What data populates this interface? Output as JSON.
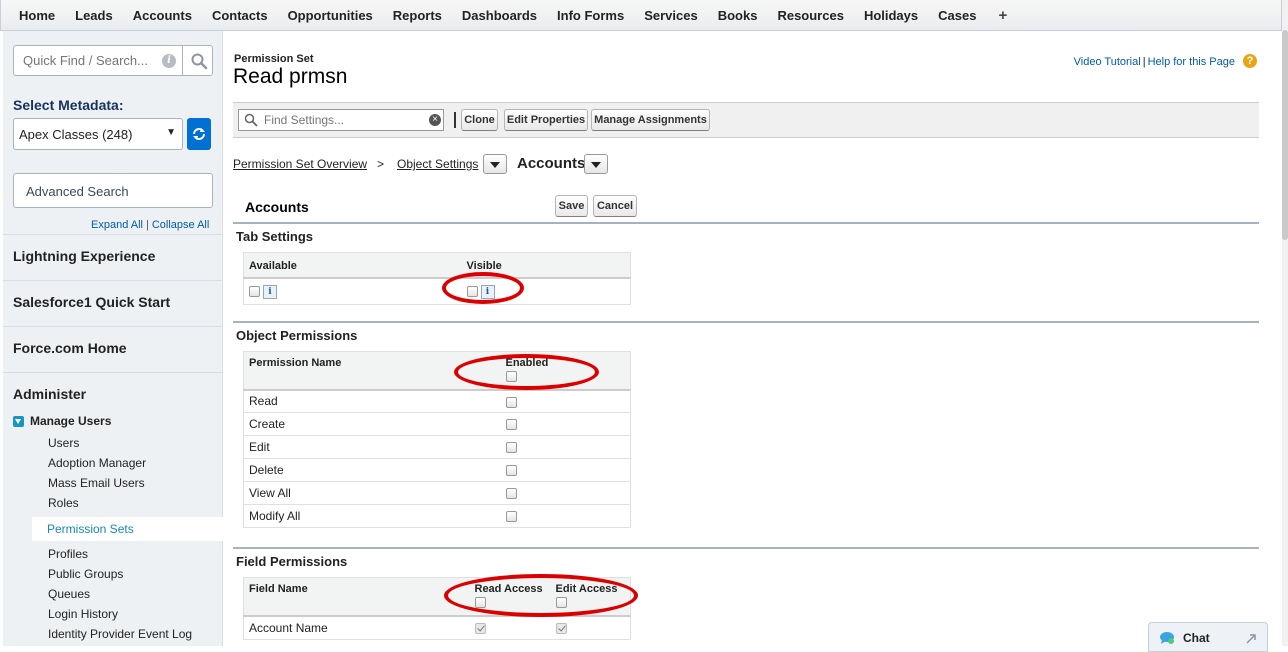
{
  "nav": {
    "tabs": [
      "Home",
      "Leads",
      "Accounts",
      "Contacts",
      "Opportunities",
      "Reports",
      "Dashboards",
      "Info Forms",
      "Services",
      "Books",
      "Resources",
      "Holidays",
      "Cases"
    ],
    "plus": "+"
  },
  "sidebar": {
    "quick_find_placeholder": "Quick Find / Search...",
    "select_metadata_label": "Select Metadata:",
    "metadata_value": "Apex Classes (248)",
    "advanced_search_placeholder": "Advanced Search",
    "expand_all": "Expand All",
    "collapse_all": "Collapse All",
    "sections": [
      "Lightning Experience",
      "Salesforce1 Quick Start",
      "Force.com Home",
      "Administer"
    ],
    "manage_users": "Manage Users",
    "sub_items": [
      "Users",
      "Adoption Manager",
      "Mass Email Users",
      "Roles",
      "Permission Sets",
      "Profiles",
      "Public Groups",
      "Queues",
      "Login History",
      "Identity Provider Event Log"
    ]
  },
  "header": {
    "label": "Permission Set",
    "title": "Read prmsn",
    "video_tutorial": "Video Tutorial",
    "help_page": "Help for this Page",
    "help_icon": "?"
  },
  "toolbar": {
    "find_placeholder": "Find Settings...",
    "clone": "Clone",
    "edit_properties": "Edit Properties",
    "manage_assignments": "Manage Assignments"
  },
  "breadcrumb": {
    "overview": "Permission Set Overview",
    "sep": ">",
    "object_settings": "Object Settings",
    "current": "Accounts"
  },
  "object": {
    "title": "Accounts",
    "save": "Save",
    "cancel": "Cancel"
  },
  "tab_settings": {
    "title": "Tab Settings",
    "col_available": "Available",
    "col_visible": "Visible"
  },
  "object_permissions": {
    "title": "Object Permissions",
    "col_name": "Permission Name",
    "col_enabled": "Enabled",
    "rows": [
      "Read",
      "Create",
      "Edit",
      "Delete",
      "View All",
      "Modify All"
    ]
  },
  "field_permissions": {
    "title": "Field Permissions",
    "col_name": "Field Name",
    "col_read": "Read Access",
    "col_edit": "Edit Access",
    "rows": [
      {
        "name": "Account Name",
        "read": true,
        "edit": true
      }
    ]
  },
  "chat": {
    "label": "Chat"
  },
  "colors": {
    "annotation": "#dd0000",
    "sidebar_link": "#1589b5",
    "link": "#015ba7"
  }
}
